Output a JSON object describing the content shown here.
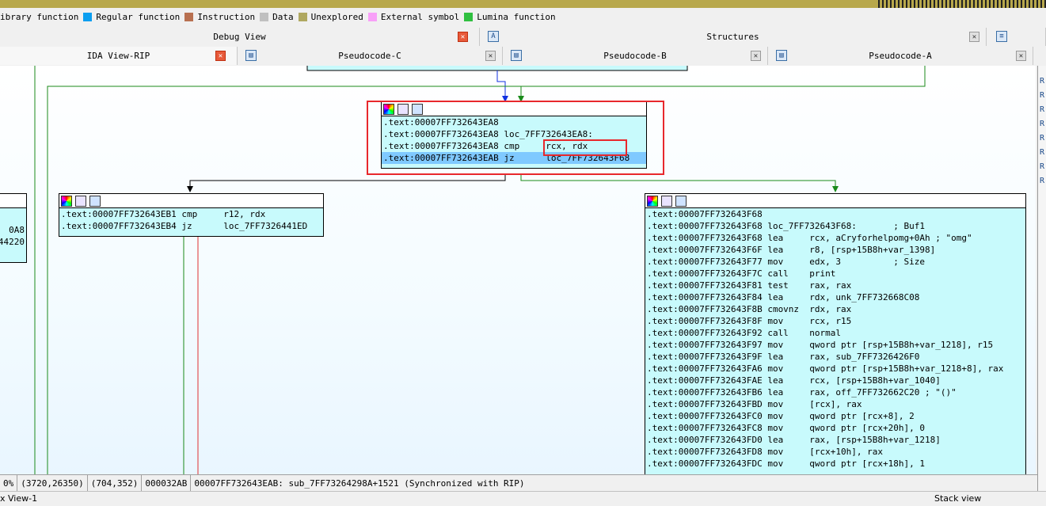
{
  "legend": [
    {
      "label": "ibrary function",
      "color": "#f0f0f0"
    },
    {
      "label": "Regular function",
      "color": "#0a9ef0"
    },
    {
      "label": "Instruction",
      "color": "#b87050"
    },
    {
      "label": "Data",
      "color": "#c0c0c0"
    },
    {
      "label": "Unexplored",
      "color": "#b0a860"
    },
    {
      "label": "External symbol",
      "color": "#f8a0f8"
    },
    {
      "label": "Lumina function",
      "color": "#30c040"
    }
  ],
  "tabs_row1": {
    "debug_view": "Debug View",
    "structures": "Structures"
  },
  "tabs_row2": {
    "ida_view": "IDA View-RIP",
    "pseudo_c": "Pseudocode-C",
    "pseudo_b": "Pseudocode-B",
    "pseudo_a": "Pseudocode-A"
  },
  "node_top": {
    "lines": [
      ".text:00007FF732643EA8",
      ".text:00007FF732643EA8 loc_7FF732643EA8:",
      ".text:00007FF732643EA8 cmp     rcx, rdx",
      ".text:00007FF732643EAB jz      loc_7FF732643F68"
    ]
  },
  "node_left": {
    "lines": [
      ".text:00007FF732643EB1 cmp     r12, rdx",
      ".text:00007FF732643EB4 jz      loc_7FF7326441ED"
    ]
  },
  "node_left_stub": {
    "line1": "0A8",
    "line2": "44220"
  },
  "node_right": {
    "lines": [
      ".text:00007FF732643F68",
      ".text:00007FF732643F68 loc_7FF732643F68:       ; Buf1",
      ".text:00007FF732643F68 lea     rcx, aCryforhelpomg+0Ah ; \"omg\"",
      ".text:00007FF732643F6F lea     r8, [rsp+15B8h+var_1398]",
      ".text:00007FF732643F77 mov     edx, 3          ; Size",
      ".text:00007FF732643F7C call    print",
      ".text:00007FF732643F81 test    rax, rax",
      ".text:00007FF732643F84 lea     rdx, unk_7FF732668C08",
      ".text:00007FF732643F8B cmovnz  rdx, rax",
      ".text:00007FF732643F8F mov     rcx, r15",
      ".text:00007FF732643F92 call    normal",
      ".text:00007FF732643F97 mov     qword ptr [rsp+15B8h+var_1218], r15",
      ".text:00007FF732643F9F lea     rax, sub_7FF7326426F0",
      ".text:00007FF732643FA6 mov     qword ptr [rsp+15B8h+var_1218+8], rax",
      ".text:00007FF732643FAE lea     rcx, [rsp+15B8h+var_1040]",
      ".text:00007FF732643FB6 lea     rax, off_7FF732662C20 ; \"()\"",
      ".text:00007FF732643FBD mov     [rcx], rax",
      ".text:00007FF732643FC0 mov     qword ptr [rcx+8], 2",
      ".text:00007FF732643FC8 mov     qword ptr [rcx+20h], 0",
      ".text:00007FF732643FD0 lea     rax, [rsp+15B8h+var_1218]",
      ".text:00007FF732643FD8 mov     [rcx+10h], rax",
      ".text:00007FF732643FDC mov     qword ptr [rcx+18h], 1"
    ]
  },
  "status": {
    "zoom": "0%",
    "coords": "(3720,26350)",
    "pos": "(704,352)",
    "offset": "000032AB",
    "addr": "00007FF732643EAB: sub_7FF73264298A+1521 (Synchronized with RIP)"
  },
  "bottom": {
    "left": "x View-1",
    "right": "Stack view"
  },
  "right_panel": [
    "R",
    "R",
    "R",
    "R",
    "R",
    "R",
    "R",
    "R"
  ]
}
